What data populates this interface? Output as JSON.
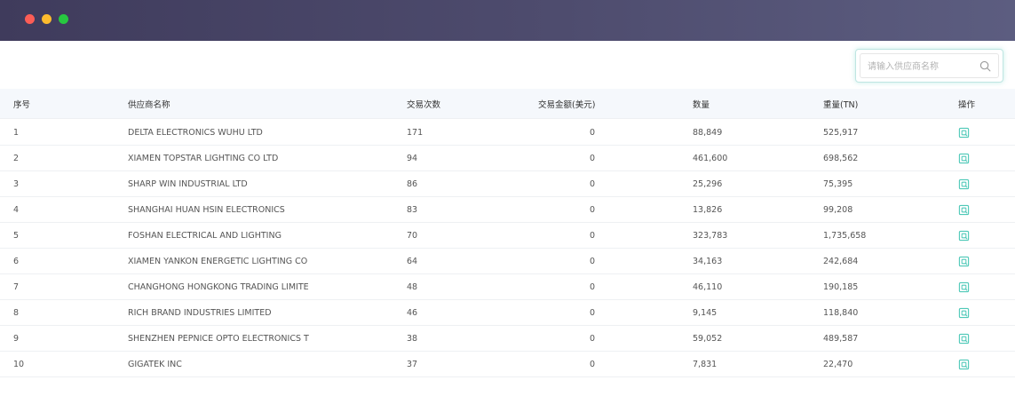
{
  "window": {
    "buttons": [
      "close",
      "minimize",
      "zoom"
    ]
  },
  "search": {
    "placeholder": "请输入供应商名称",
    "icon": "search-icon"
  },
  "table": {
    "columns": {
      "index": "序号",
      "supplier": "供应商名称",
      "transactions": "交易次数",
      "amount": "交易金额(美元)",
      "quantity": "数量",
      "weight": "重量(TN)",
      "action": "操作"
    },
    "rows": [
      {
        "index": "1",
        "supplier": "DELTA ELECTRONICS WUHU LTD",
        "transactions": "171",
        "amount": "0",
        "quantity": "88,849",
        "weight": "525,917"
      },
      {
        "index": "2",
        "supplier": "XIAMEN TOPSTAR LIGHTING CO LTD",
        "transactions": "94",
        "amount": "0",
        "quantity": "461,600",
        "weight": "698,562"
      },
      {
        "index": "3",
        "supplier": "SHARP WIN INDUSTRIAL LTD",
        "transactions": "86",
        "amount": "0",
        "quantity": "25,296",
        "weight": "75,395"
      },
      {
        "index": "4",
        "supplier": "SHANGHAI HUAN HSIN ELECTRONICS",
        "transactions": "83",
        "amount": "0",
        "quantity": "13,826",
        "weight": "99,208"
      },
      {
        "index": "5",
        "supplier": "FOSHAN ELECTRICAL AND LIGHTING",
        "transactions": "70",
        "amount": "0",
        "quantity": "323,783",
        "weight": "1,735,658"
      },
      {
        "index": "6",
        "supplier": "XIAMEN YANKON ENERGETIC LIGHTING CO",
        "transactions": "64",
        "amount": "0",
        "quantity": "34,163",
        "weight": "242,684"
      },
      {
        "index": "7",
        "supplier": "CHANGHONG HONGKONG TRADING LIMITE",
        "transactions": "48",
        "amount": "0",
        "quantity": "46,110",
        "weight": "190,185"
      },
      {
        "index": "8",
        "supplier": "RICH BRAND INDUSTRIES LIMITED",
        "transactions": "46",
        "amount": "0",
        "quantity": "9,145",
        "weight": "118,840"
      },
      {
        "index": "9",
        "supplier": "SHENZHEN PEPNICE OPTO ELECTRONICS T",
        "transactions": "38",
        "amount": "0",
        "quantity": "59,052",
        "weight": "489,587"
      },
      {
        "index": "10",
        "supplier": "GIGATEK INC",
        "transactions": "37",
        "amount": "0",
        "quantity": "7,831",
        "weight": "22,470"
      }
    ],
    "action_icon": "view-detail-icon"
  },
  "colors": {
    "titlebar": "#4e4c6e",
    "accent": "#4fc9b8",
    "header_bg": "#f5f8fc"
  }
}
